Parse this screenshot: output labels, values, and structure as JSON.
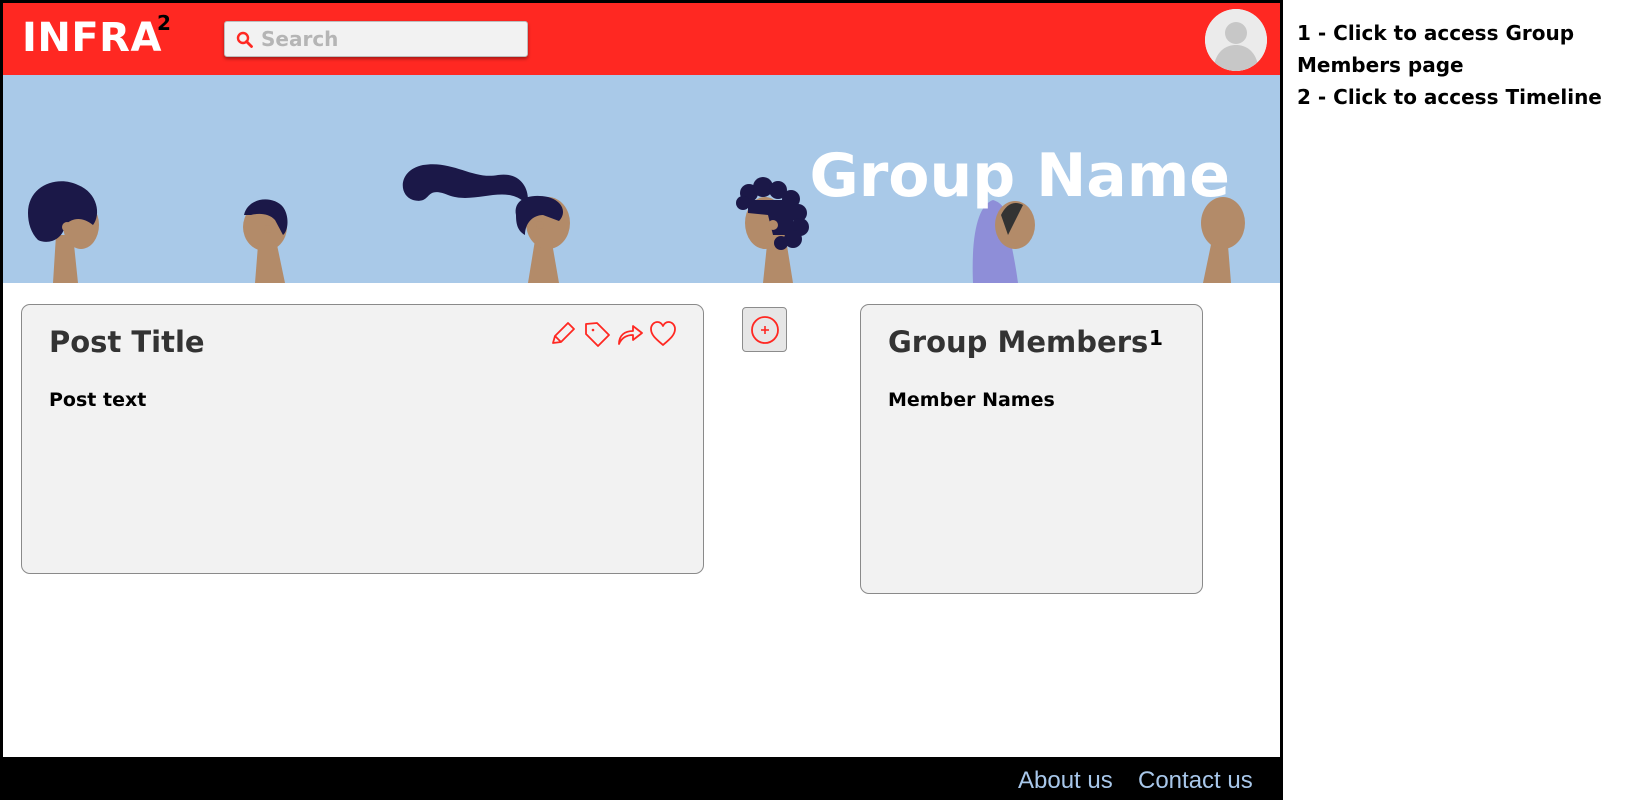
{
  "header": {
    "logo": "INFRA",
    "logo_marker": "2",
    "search_placeholder": "Search"
  },
  "banner": {
    "group_name": "Group Name"
  },
  "post": {
    "title": "Post Title",
    "text": "Post text",
    "actions": [
      "pencil-icon",
      "tag-icon",
      "share-icon",
      "heart-icon"
    ]
  },
  "add_button": {
    "icon": "plus-circle-icon"
  },
  "members": {
    "title": "Group Members",
    "marker": "1",
    "names": "Member Names"
  },
  "footer": {
    "about": "About us",
    "contact": "Contact us"
  },
  "notes": {
    "note_1": "1 - Click to access Group Members page",
    "note_2": "2 - Click to access Timeline"
  },
  "colors": {
    "header_bg": "#ff2822",
    "banner_bg": "#a9c9e8",
    "card_bg": "#f2f2f2",
    "footer_bg": "#000000",
    "footer_link": "#a8c7ea",
    "accent": "#ff2822"
  }
}
